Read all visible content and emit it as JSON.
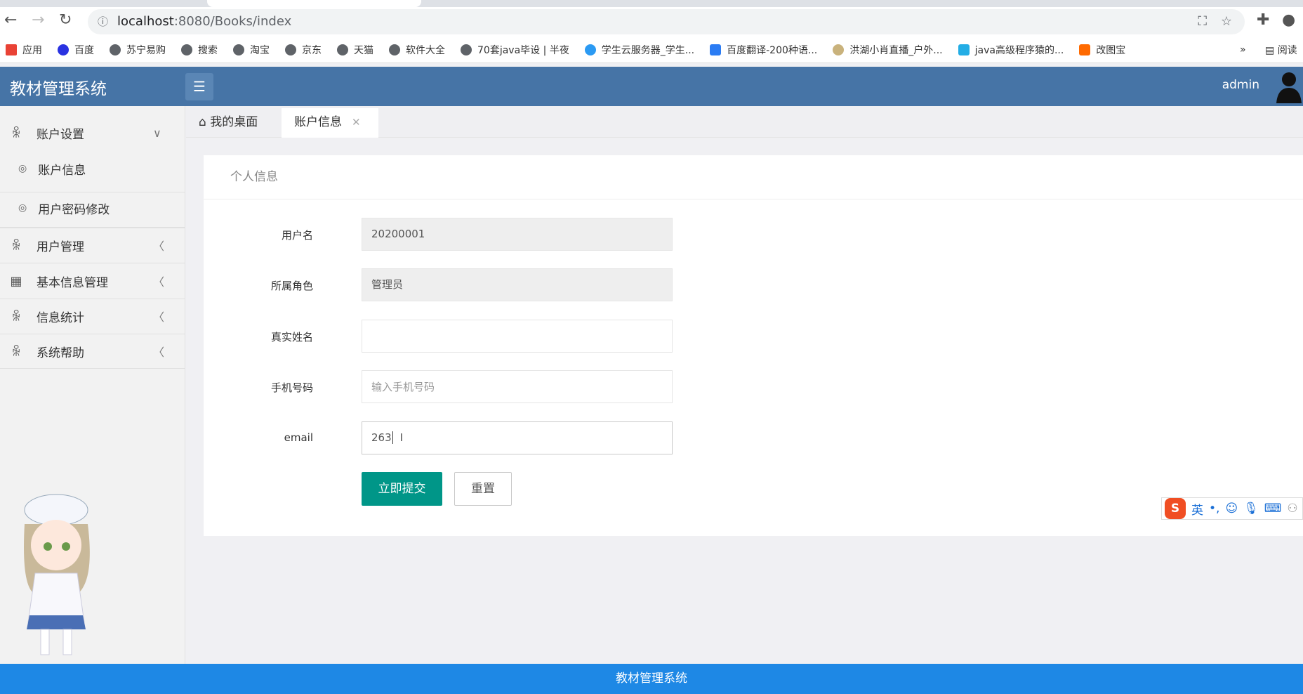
{
  "browser": {
    "url_host": "localhost",
    "url_path": ":8080/Books/index",
    "bookmarks": [
      "应用",
      "百度",
      "苏宁易购",
      "搜索",
      "淘宝",
      "京东",
      "天猫",
      "软件大全",
      "70套java毕设 | 半夜",
      "学生云服务器_学生...",
      "百度翻译-200种语...",
      "洪湖小肖直播_户外...",
      "java高级程序猿的...",
      "改图宝"
    ],
    "bookmarks_more": "»",
    "reading_list": "阅读"
  },
  "header": {
    "title": "教材管理系统",
    "user": "admin"
  },
  "sidebar": {
    "groups": [
      {
        "label": "账户设置",
        "icon": "user-icon",
        "expanded": true,
        "children": [
          "账户信息",
          "用户密码修改"
        ]
      },
      {
        "label": "用户管理",
        "icon": "user-icon"
      },
      {
        "label": "基本信息管理",
        "icon": "id-card-icon"
      },
      {
        "label": "信息统计",
        "icon": "user-icon"
      },
      {
        "label": "系统帮助",
        "icon": "user-icon"
      }
    ]
  },
  "tabs": [
    {
      "label": "我的桌面"
    },
    {
      "label": "账户信息",
      "active": true
    }
  ],
  "form": {
    "title": "个人信息",
    "fields": [
      {
        "label": "用户名",
        "value": "20200001",
        "readonly": true
      },
      {
        "label": "所属角色",
        "value": "管理员",
        "readonly": true
      },
      {
        "label": "真实姓名",
        "value": ""
      },
      {
        "label": "手机号码",
        "value": "",
        "placeholder": "输入手机号码"
      },
      {
        "label": "email",
        "value": "263"
      }
    ],
    "submit": "立即提交",
    "reset": "重置"
  },
  "ime": {
    "mode": "英"
  },
  "footer": {
    "text": "教材管理系统"
  },
  "colors": {
    "header": "#4674a6",
    "submit": "#009688",
    "footer": "#1e88e5"
  }
}
